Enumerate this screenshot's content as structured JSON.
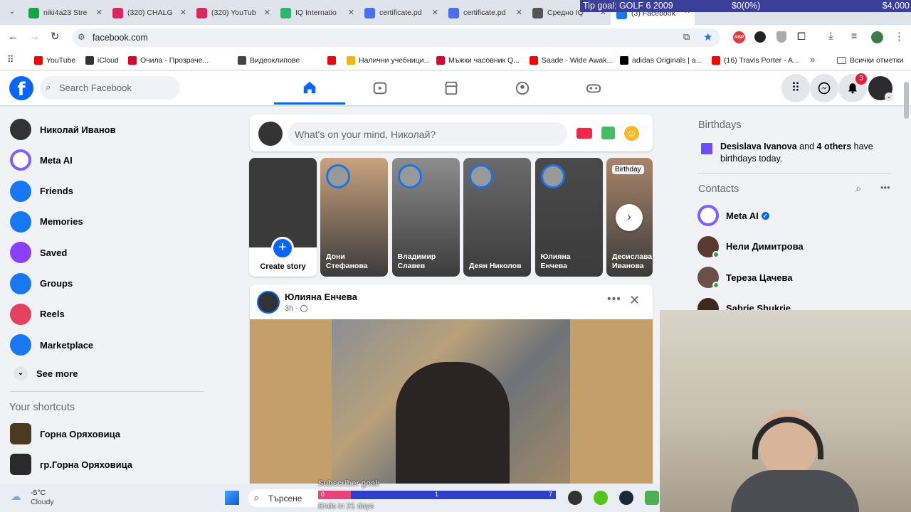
{
  "browser": {
    "tabs": [
      {
        "label": "niki4a23 Stre",
        "color": "#15a34a"
      },
      {
        "label": "(320) CHALG",
        "color": "#e0245e"
      },
      {
        "label": "(320) YouTub",
        "color": "#e0245e"
      },
      {
        "label": "IQ Internatio",
        "color": "#2bb673"
      },
      {
        "label": "certificate.pd",
        "color": "#4c6ef5"
      },
      {
        "label": "certificate.pd",
        "color": "#4c6ef5"
      },
      {
        "label": "Средно IQ",
        "color": "#555555"
      },
      {
        "label": "(3) Facebook",
        "color": "#1877f2"
      }
    ],
    "url": "facebook.com",
    "bookmarks": [
      {
        "label": "YouTube",
        "color": "#ff0000"
      },
      {
        "label": "iCloud",
        "color": "#333333"
      },
      {
        "label": "Очила - Прозраче...",
        "color": "#e4002b"
      },
      {
        "label": "Видеоклипове",
        "color": "#444444"
      },
      {
        "label": "",
        "color": "#e50914"
      },
      {
        "label": "Налични учебници...",
        "color": "#f4b400"
      },
      {
        "label": "Мъжки часовник Q...",
        "color": "#d90429"
      },
      {
        "label": "Saade - Wide Awak...",
        "color": "#ff0000"
      },
      {
        "label": "adidas Originals | a...",
        "color": "#000000"
      },
      {
        "label": "(16) Travis Porter - A...",
        "color": "#ff0000"
      }
    ],
    "all_bookmarks": "Всички отметки",
    "extensions_badge": "ABP"
  },
  "overlay": {
    "tip_goal": "Tip goal: GOLF 6 2009",
    "progress": "$0(0%)",
    "goal_amount": "$4,000",
    "subscriber_goal": "Subscriber goal:",
    "ends": "Ends in 21 days",
    "bar_start": "0",
    "bar_mid": "1",
    "bar_end": "7"
  },
  "facebook": {
    "search_placeholder": "Search Facebook",
    "notification_count": "3",
    "left_nav": [
      {
        "label": "Николай Иванов",
        "icon": "profile-avatar",
        "color": "#333333"
      },
      {
        "label": "Meta AI",
        "icon": "meta-ai-icon",
        "color": "#7b2ff7"
      },
      {
        "label": "Friends",
        "icon": "friends-icon",
        "color": "#1877f2"
      },
      {
        "label": "Memories",
        "icon": "memories-icon",
        "color": "#1877f2"
      },
      {
        "label": "Saved",
        "icon": "saved-icon",
        "color": "#8a3ffc"
      },
      {
        "label": "Groups",
        "icon": "groups-icon",
        "color": "#1877f2"
      },
      {
        "label": "Reels",
        "icon": "reels-icon",
        "color": "#e4405f"
      },
      {
        "label": "Marketplace",
        "icon": "marketplace-icon",
        "color": "#1877f2"
      }
    ],
    "see_more": "See more",
    "shortcuts_title": "Your shortcuts",
    "shortcuts": [
      {
        "label": "Горна Оряховица"
      },
      {
        "label": "гр.Горна Оряховица"
      }
    ],
    "composer_placeholder": "What's on your mind, Николай?",
    "create_story": "Create story",
    "stories": [
      {
        "name": "Дони Стефанова",
        "color": "#c9a27e"
      },
      {
        "name": "Владимир Славев",
        "color": "#8d8d8d"
      },
      {
        "name": "Деян Николов",
        "color": "#6b6b6b"
      },
      {
        "name": "Юлияна Енчева",
        "color": "#4a4a4a"
      },
      {
        "name": "Десислава Иванова",
        "color": "#a8866a",
        "badge": "Birthday"
      }
    ],
    "post": {
      "author": "Юлияна Енчева",
      "time": "3h ·"
    },
    "birthdays": {
      "title": "Birthdays",
      "name": "Desislava Ivanova",
      "and": " and ",
      "others": "4 others",
      "rest": " have birthdays today."
    },
    "contacts_title": "Contacts",
    "contacts": [
      {
        "name": "Meta AI",
        "online": false
      },
      {
        "name": "Нели Димитрова",
        "online": true
      },
      {
        "name": "Тереза Цачева",
        "online": true
      },
      {
        "name": "Sabrie Shukrie",
        "online": false
      }
    ]
  },
  "taskbar": {
    "weather_temp": "-5°C",
    "weather_desc": "Cloudy",
    "search_placeholder": "Търсене"
  }
}
